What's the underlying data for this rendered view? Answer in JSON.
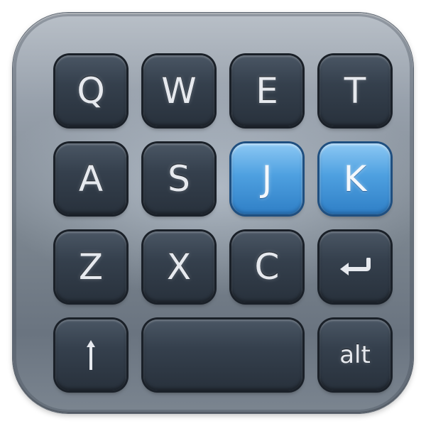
{
  "keyboard": {
    "row1": [
      "Q",
      "W",
      "E",
      "T"
    ],
    "row2": [
      "A",
      "S",
      "J",
      "K"
    ],
    "row3": [
      "Z",
      "X",
      "C"
    ],
    "alt_label": "alt",
    "highlighted_keys": [
      "J",
      "K"
    ],
    "icons": {
      "enter": "return-arrow-icon",
      "shift": "shift-bar-icon"
    },
    "colors": {
      "key": "#2f3944",
      "highlight": "#4ea0e0",
      "frame": "#8a939d"
    }
  }
}
